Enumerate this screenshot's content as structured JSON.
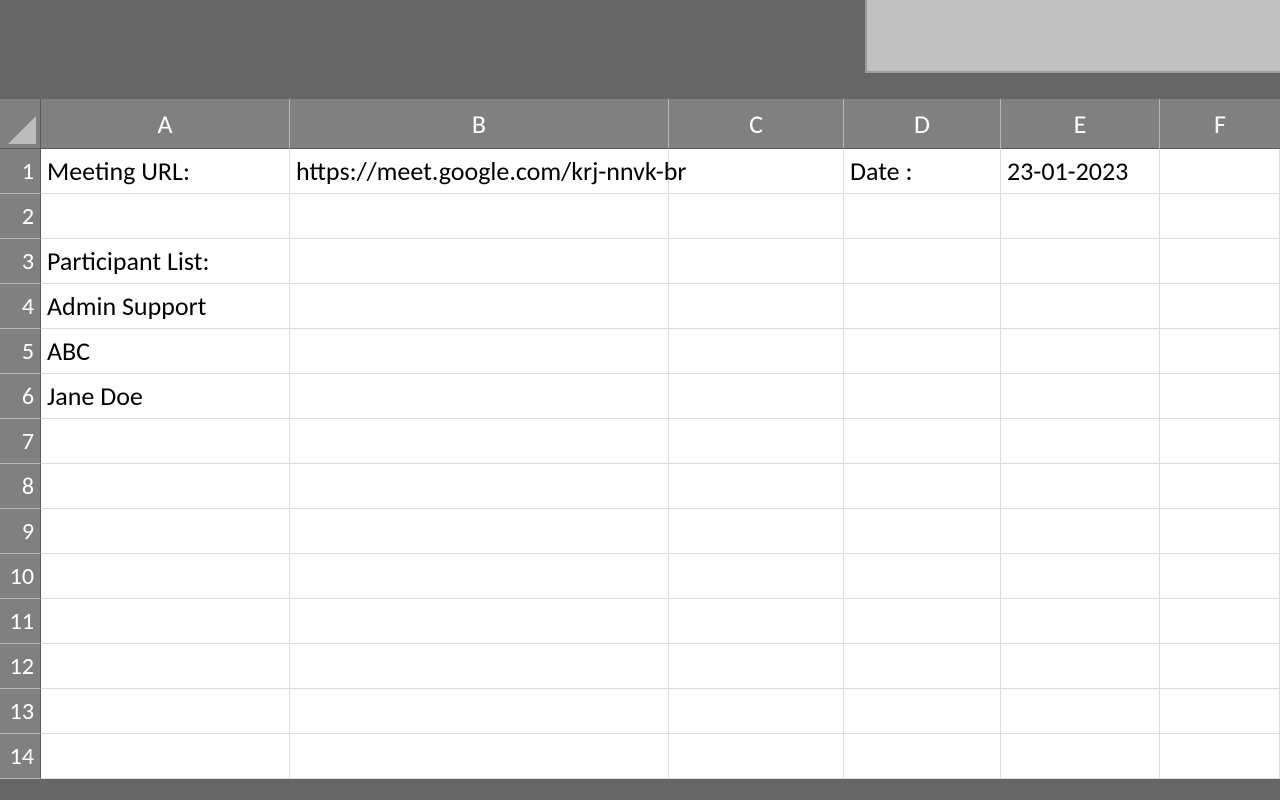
{
  "columns": [
    "A",
    "B",
    "C",
    "D",
    "E",
    "F"
  ],
  "rows": [
    "1",
    "2",
    "3",
    "4",
    "5",
    "6",
    "7",
    "8",
    "9",
    "10",
    "11",
    "12",
    "13",
    "14"
  ],
  "cells": {
    "A1": "Meeting URL:",
    "B1": "https://meet.google.com/krj-nnvk-br",
    "D1": "Date :",
    "E1": "23-01-2023",
    "A3": "Participant List:",
    "A4": "Admin Support",
    "A5": "ABC",
    "A6": "Jane Doe"
  }
}
